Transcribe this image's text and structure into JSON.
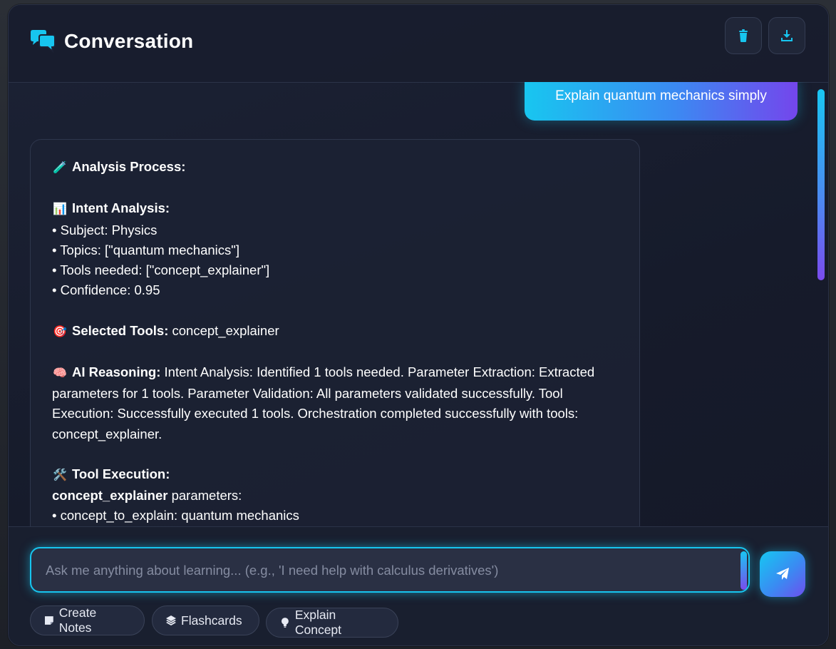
{
  "header": {
    "title": "Conversation",
    "icons": {
      "chat": "comments-icon",
      "delete": "trash-icon",
      "download": "download-icon"
    }
  },
  "messages": {
    "user": "Explain quantum mechanics simply",
    "ai": {
      "analysis_heading": "Analysis Process:",
      "intent_heading": "Intent Analysis:",
      "intent_lines": [
        "• Subject: Physics",
        "• Topics: [\"quantum mechanics\"]",
        "• Tools needed: [\"concept_explainer\"]",
        "• Confidence: 0.95"
      ],
      "selected_tools_label": "Selected Tools:",
      "selected_tools_value": " concept_explainer",
      "reasoning_label": "AI Reasoning:",
      "reasoning_text": " Intent Analysis: Identified 1 tools needed. Parameter Extraction: Extracted parameters for 1 tools. Parameter Validation: All parameters validated successfully. Tool Execution: Successfully executed 1 tools. Orchestration completed successfully with tools: concept_explainer.",
      "tool_exec_heading": "Tool Execution:",
      "tool_name": "concept_explainer",
      "tool_params_suffix": " parameters:",
      "tool_param_lines": [
        "• concept_to_explain: quantum mechanics"
      ],
      "emojis": {
        "analysis": "🧪",
        "intent": "📊",
        "tools": "🎯",
        "reasoning": "🧠",
        "execution": "🛠️"
      }
    }
  },
  "composer": {
    "placeholder": "Ask me anything about learning... (e.g., 'I need help with calculus derivatives')",
    "value": "",
    "send_icon": "paper-plane-icon"
  },
  "quick_actions": [
    {
      "label": "Create Notes",
      "icon": "sticky-note-icon"
    },
    {
      "label": "Flashcards",
      "icon": "layers-icon"
    },
    {
      "label": "Explain Concept",
      "icon": "lightbulb-icon"
    }
  ],
  "colors": {
    "accent_cyan": "#18c6f0",
    "accent_purple": "#7446ec",
    "panel_bg": "#181d2c",
    "icon_cyan": "#17c5ef"
  }
}
